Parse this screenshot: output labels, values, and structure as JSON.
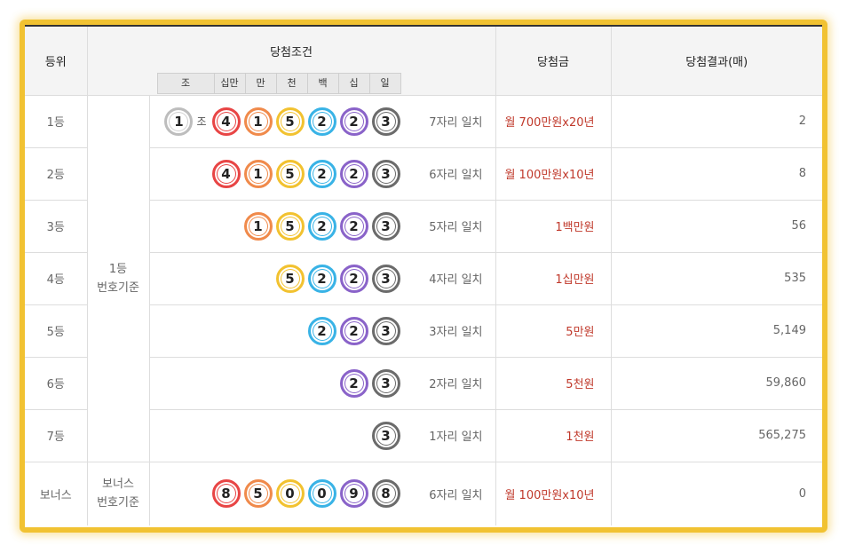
{
  "header": {
    "rank": "등위",
    "condition": "당첨조건",
    "prize": "당첨금",
    "result": "당첨결과(매)",
    "digits": [
      "조",
      "십만",
      "만",
      "천",
      "백",
      "십",
      "일"
    ]
  },
  "basis": {
    "main": [
      "1등",
      "번호기준"
    ],
    "bonus": [
      "보너스",
      "번호기준"
    ]
  },
  "jo_label": "조",
  "colors": {
    "red": "#e84545",
    "orange": "#f08a4b",
    "yellow": "#f2c230",
    "blue": "#39b3e6",
    "purple": "#8a63c9",
    "gray": "#6b6b6b",
    "white": "#bdbdbd",
    "prize_text": "#c0392b",
    "frame": "#f1c232"
  },
  "rows": [
    {
      "rank": "1등",
      "jo": "1",
      "balls": [
        "4",
        "1",
        "5",
        "2",
        "2",
        "3"
      ],
      "match": "7자리 일치",
      "prize": "월 700만원x20년",
      "result": "2"
    },
    {
      "rank": "2등",
      "balls": [
        "4",
        "1",
        "5",
        "2",
        "2",
        "3"
      ],
      "match": "6자리 일치",
      "prize": "월 100만원x10년",
      "result": "8"
    },
    {
      "rank": "3등",
      "balls": [
        "1",
        "5",
        "2",
        "2",
        "3"
      ],
      "match": "5자리 일치",
      "prize": "1백만원",
      "result": "56"
    },
    {
      "rank": "4등",
      "balls": [
        "5",
        "2",
        "2",
        "3"
      ],
      "match": "4자리 일치",
      "prize": "1십만원",
      "result": "535"
    },
    {
      "rank": "5등",
      "balls": [
        "2",
        "2",
        "3"
      ],
      "match": "3자리 일치",
      "prize": "5만원",
      "result": "5,149"
    },
    {
      "rank": "6등",
      "balls": [
        "2",
        "3"
      ],
      "match": "2자리 일치",
      "prize": "5천원",
      "result": "59,860"
    },
    {
      "rank": "7등",
      "balls": [
        "3"
      ],
      "match": "1자리 일치",
      "prize": "1천원",
      "result": "565,275"
    },
    {
      "rank": "보너스",
      "balls": [
        "8",
        "5",
        "0",
        "0",
        "9",
        "8"
      ],
      "match": "6자리 일치",
      "prize": "월 100만원x10년",
      "result": "0"
    }
  ]
}
